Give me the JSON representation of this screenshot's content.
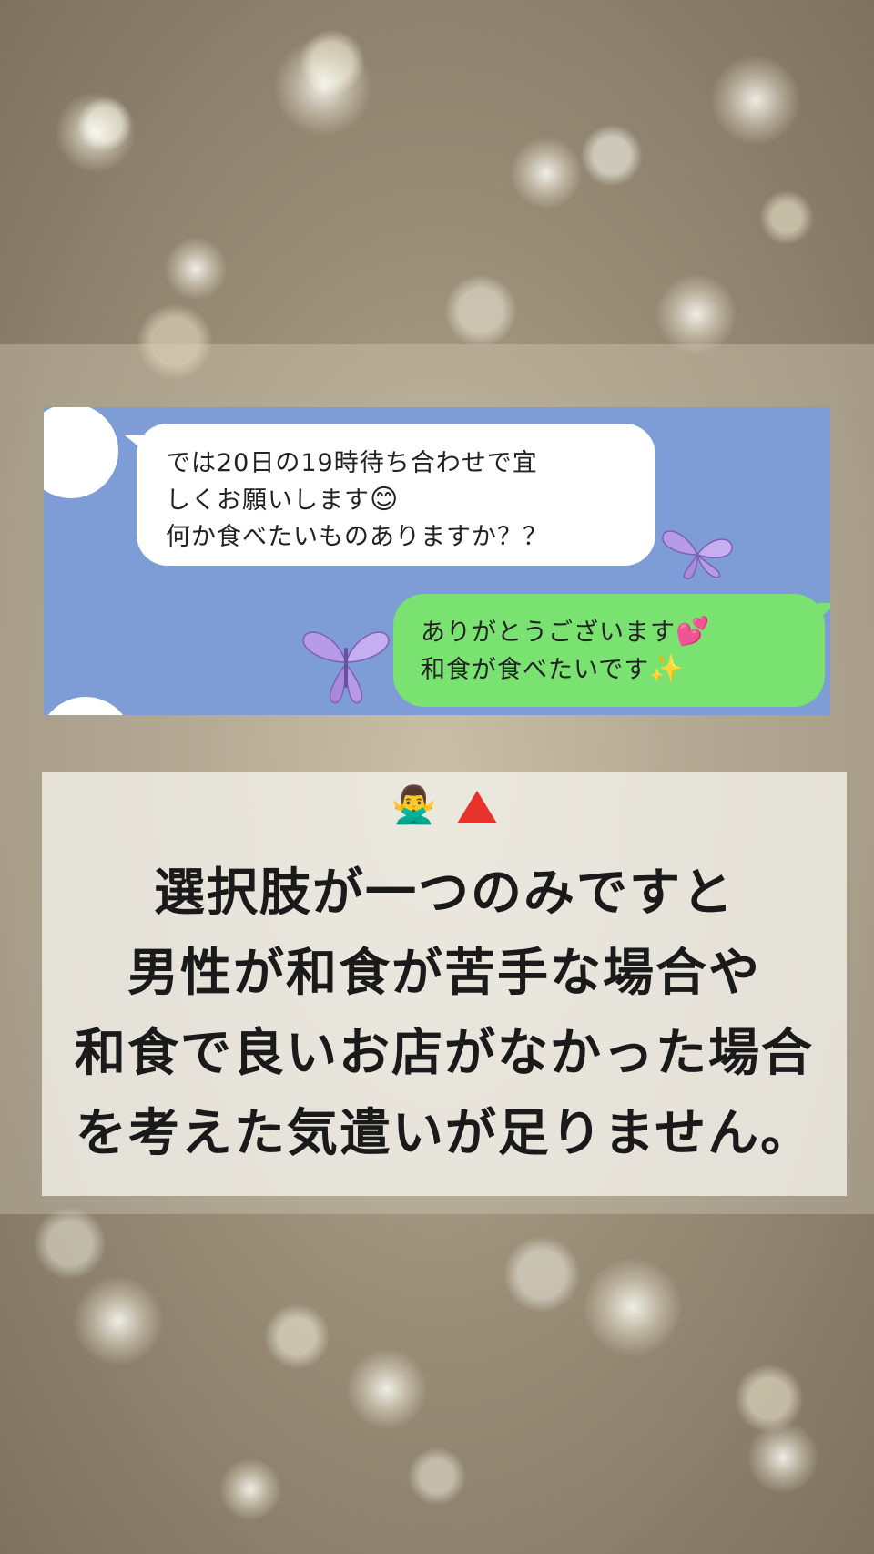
{
  "chat": {
    "incoming_message": {
      "lines": [
        "では20日の19時待ち合わせで宜",
        "しくお願いします",
        "何か食べたいものありますか？？"
      ],
      "emoji": "😊"
    },
    "outgoing_message": {
      "lines": [
        "ありがとうございます",
        "和食が食べたいです"
      ],
      "emoji_1": "💕",
      "emoji_2": "✨"
    },
    "background_color": "#7e9cd6",
    "incoming_bubble_color": "#ffffff",
    "outgoing_bubble_color": "#79e271"
  },
  "caption": {
    "icons": {
      "person": "🙅‍♂️",
      "triangle": "red-triangle-icon"
    },
    "lines": [
      "選択肢が一つのみですと",
      "男性が和食が苦手な場合や",
      "和食で良いお店がなかった場合",
      "を考えた気遣いが足りません。"
    ]
  }
}
